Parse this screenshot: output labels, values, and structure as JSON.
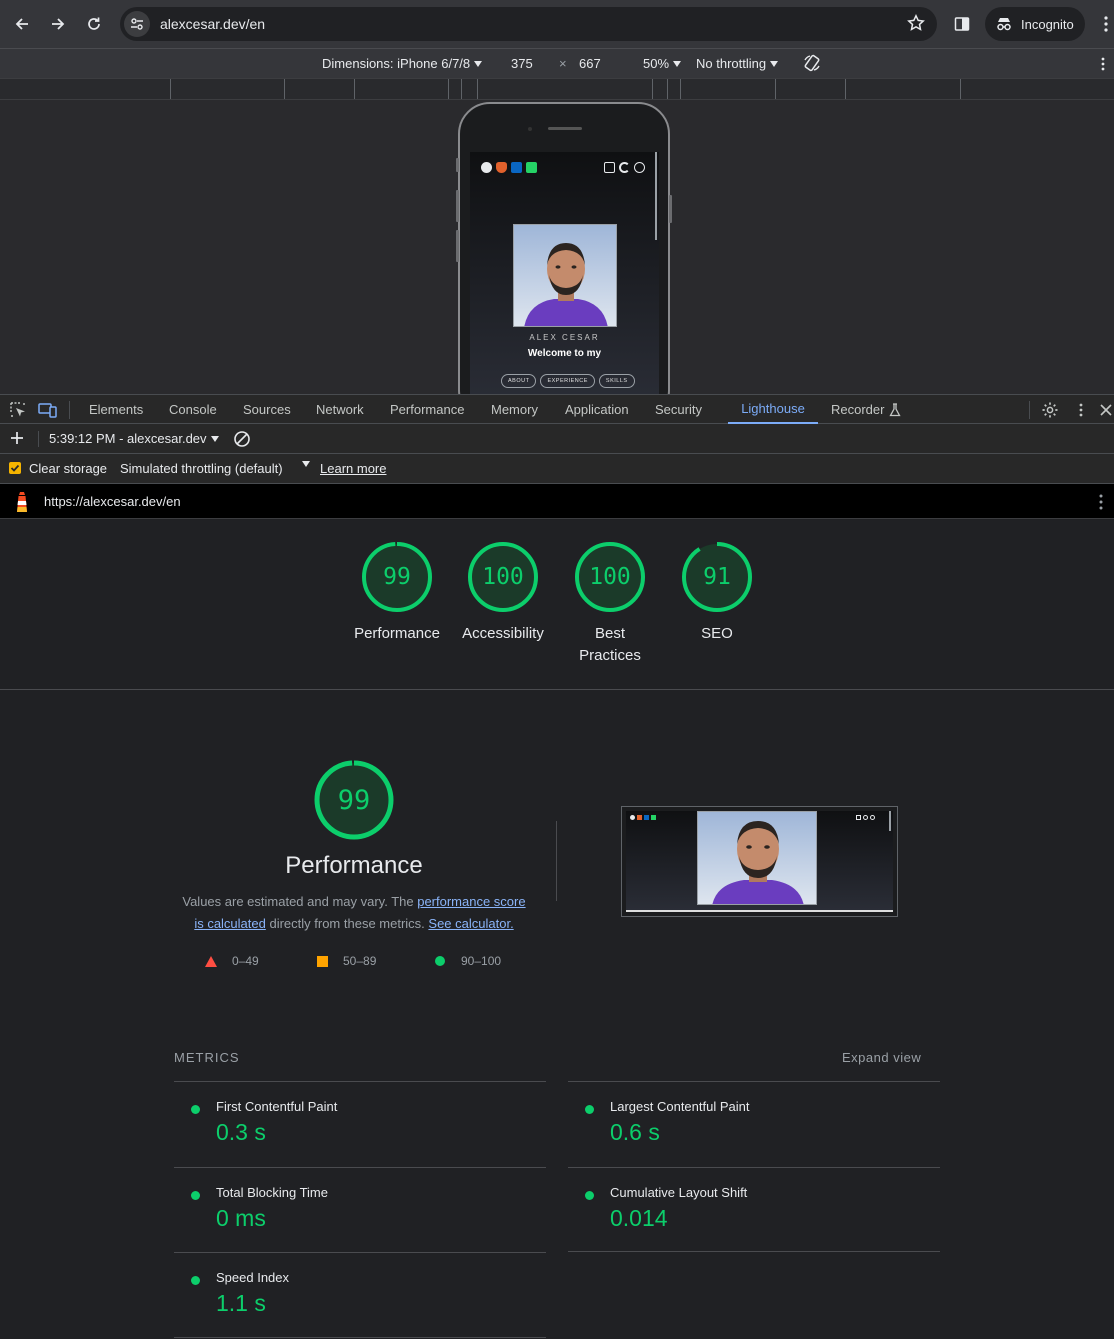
{
  "browser": {
    "url": "alexcesar.dev/en",
    "incognito_label": "Incognito"
  },
  "device_toolbar": {
    "dimensions_label": "Dimensions: iPhone 6/7/8",
    "width": "375",
    "times": "×",
    "height": "667",
    "zoom": "50%",
    "throttling": "No throttling"
  },
  "site": {
    "name": "ALEX CESAR",
    "welcome": "Welcome to my",
    "nav": [
      "ABOUT",
      "EXPERIENCE",
      "SKILLS"
    ]
  },
  "devtools": {
    "tabs": [
      "Elements",
      "Console",
      "Sources",
      "Network",
      "Performance",
      "Memory",
      "Application",
      "Security",
      "Lighthouse",
      "Recorder"
    ],
    "active_tab": "Lighthouse",
    "report_selector": "5:39:12 PM - alexcesar.dev",
    "clear_storage": "Clear storage",
    "throttling_mode": "Simulated throttling (default)",
    "learn_more": "Learn more",
    "report_url": "https://alexcesar.dev/en"
  },
  "scores": [
    {
      "label": "Performance",
      "value": "99",
      "score": 0.99
    },
    {
      "label": "Accessibility",
      "value": "100",
      "score": 1.0
    },
    {
      "label_line1": "Best",
      "label_line2": "Practices",
      "value": "100",
      "score": 1.0
    },
    {
      "label": "SEO",
      "value": "91",
      "score": 0.91
    }
  ],
  "performance": {
    "score": "99",
    "title": "Performance",
    "desc_1": "Values are estimated and may vary. The ",
    "desc_link_1a": "performance score",
    "desc_link_1b": "is calculated",
    "desc_2": " directly from these metrics. ",
    "desc_link_2": "See calculator.",
    "legend": [
      {
        "range": "0–49",
        "color": "#ff4e42"
      },
      {
        "range": "50–89",
        "color": "#ffa400"
      },
      {
        "range": "90–100",
        "color": "#0cce6b"
      }
    ]
  },
  "metrics": {
    "heading": "METRICS",
    "expand": "Expand view",
    "items": [
      {
        "title": "First Contentful Paint",
        "value": "0.3 s"
      },
      {
        "title": "Largest Contentful Paint",
        "value": "0.6 s"
      },
      {
        "title": "Total Blocking Time",
        "value": "0 ms"
      },
      {
        "title": "Cumulative Layout Shift",
        "value": "0.014"
      },
      {
        "title": "Speed Index",
        "value": "1.1 s"
      }
    ]
  },
  "colors": {
    "pass": "#0cce6b",
    "accent": "#7cacf8"
  }
}
